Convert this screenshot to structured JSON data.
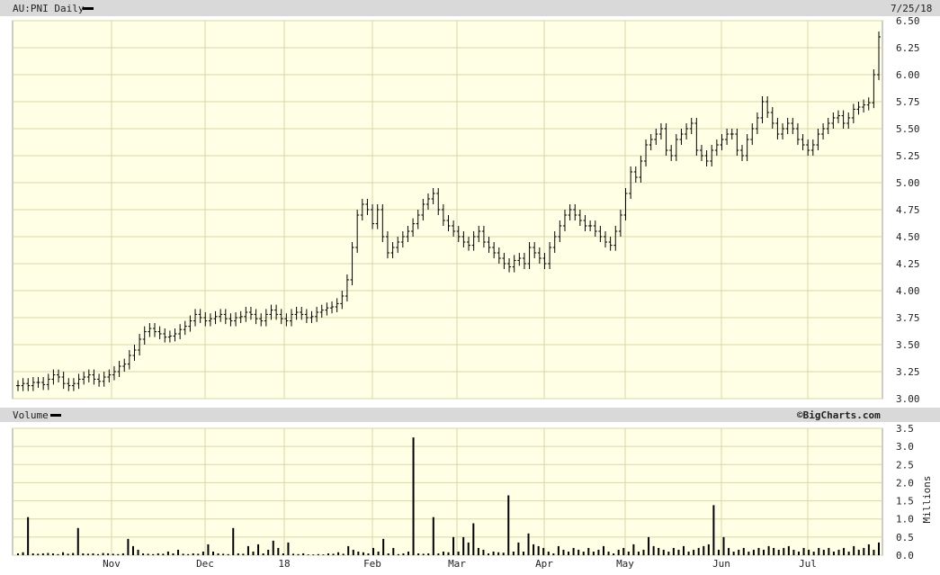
{
  "header": {
    "symbol_label": "AU:PNI Daily",
    "date_label": "7/25/18",
    "volume_label": "Volume",
    "brand": "©BigCharts.com",
    "volume_unit": "Millions"
  },
  "colors": {
    "panel_bg": "#ffffe6",
    "grid": "#d8d6a8",
    "header_bg": "#d9d9d9",
    "ink": "#000000"
  },
  "chart_data": [
    {
      "type": "line",
      "style": "ohlc",
      "title": "AU:PNI Daily",
      "x_tick_labels": [
        "Nov",
        "Dec",
        "18",
        "Feb",
        "Mar",
        "Apr",
        "May",
        "Jun",
        "Jul"
      ],
      "y_tick_labels": [
        "3.00",
        "3.25",
        "3.50",
        "3.75",
        "4.00",
        "4.25",
        "4.50",
        "4.75",
        "5.00",
        "5.25",
        "5.50",
        "5.75",
        "6.00",
        "6.25",
        "6.50"
      ],
      "ylim": [
        3.0,
        6.5
      ],
      "grid": true,
      "series": [
        {
          "values": [
            3.12,
            3.14,
            3.12,
            3.15,
            3.15,
            3.13,
            3.18,
            3.22,
            3.2,
            3.14,
            3.12,
            3.14,
            3.18,
            3.2,
            3.22,
            3.18,
            3.16,
            3.2,
            3.22,
            3.25,
            3.3,
            3.32,
            3.4,
            3.45,
            3.55,
            3.62,
            3.65,
            3.62,
            3.6,
            3.57,
            3.58,
            3.6,
            3.64,
            3.67,
            3.72,
            3.78,
            3.75,
            3.72,
            3.74,
            3.76,
            3.78,
            3.74,
            3.72,
            3.75,
            3.76,
            3.8,
            3.78,
            3.74,
            3.72,
            3.78,
            3.82,
            3.78,
            3.74,
            3.72,
            3.78,
            3.8,
            3.78,
            3.75,
            3.76,
            3.8,
            3.82,
            3.84,
            3.85,
            3.88,
            3.95,
            4.1,
            4.4,
            4.7,
            4.8,
            4.75,
            4.62,
            4.75,
            4.5,
            4.35,
            4.4,
            4.45,
            4.5,
            4.55,
            4.62,
            4.7,
            4.8,
            4.85,
            4.9,
            4.75,
            4.65,
            4.6,
            4.55,
            4.5,
            4.45,
            4.42,
            4.5,
            4.55,
            4.45,
            4.4,
            4.35,
            4.3,
            4.25,
            4.22,
            4.28,
            4.3,
            4.25,
            4.4,
            4.35,
            4.3,
            4.25,
            4.4,
            4.5,
            4.6,
            4.7,
            4.75,
            4.7,
            4.65,
            4.6,
            4.6,
            4.55,
            4.5,
            4.45,
            4.42,
            4.55,
            4.7,
            4.9,
            5.1,
            5.05,
            5.2,
            5.35,
            5.4,
            5.45,
            5.5,
            5.3,
            5.25,
            5.4,
            5.45,
            5.5,
            5.55,
            5.3,
            5.25,
            5.2,
            5.3,
            5.35,
            5.4,
            5.45,
            5.45,
            5.3,
            5.25,
            5.4,
            5.5,
            5.6,
            5.75,
            5.65,
            5.55,
            5.45,
            5.5,
            5.55,
            5.5,
            5.4,
            5.35,
            5.3,
            5.35,
            5.45,
            5.5,
            5.55,
            5.6,
            5.62,
            5.55,
            5.6,
            5.68,
            5.7,
            5.72,
            5.74,
            6.0,
            6.35
          ]
        }
      ]
    },
    {
      "type": "bar",
      "title": "Volume",
      "ylabel": "Millions",
      "x_tick_labels": [
        "Nov",
        "Dec",
        "18",
        "Feb",
        "Mar",
        "Apr",
        "May",
        "Jun",
        "Jul"
      ],
      "y_tick_labels": [
        "0.0",
        "0.5",
        "1.0",
        "1.5",
        "2.0",
        "2.5",
        "3.0",
        "3.5"
      ],
      "ylim": [
        0,
        3.5
      ],
      "grid": true,
      "series": [
        {
          "values": [
            0.05,
            0.08,
            1.05,
            0.05,
            0.04,
            0.05,
            0.06,
            0.05,
            0.03,
            0.08,
            0.04,
            0.06,
            0.75,
            0.05,
            0.04,
            0.05,
            0.03,
            0.06,
            0.05,
            0.04,
            0.03,
            0.05,
            0.45,
            0.25,
            0.15,
            0.05,
            0.04,
            0.03,
            0.05,
            0.04,
            0.1,
            0.05,
            0.15,
            0.04,
            0.03,
            0.05,
            0.04,
            0.1,
            0.3,
            0.1,
            0.05,
            0.04,
            0.03,
            0.75,
            0.05,
            0.04,
            0.25,
            0.1,
            0.3,
            0.05,
            0.15,
            0.4,
            0.2,
            0.05,
            0.35,
            0.04,
            0.03,
            0.05,
            0.02,
            0.02,
            0.03,
            0.02,
            0.05,
            0.04,
            0.08,
            0.04,
            0.25,
            0.15,
            0.1,
            0.08,
            0.05,
            0.2,
            0.1,
            0.45,
            0.05,
            0.2,
            0.03,
            0.05,
            0.1,
            3.25,
            0.05,
            0.04,
            0.05,
            1.05,
            0.05,
            0.1,
            0.08,
            0.5,
            0.1,
            0.5,
            0.35,
            0.88,
            0.2,
            0.15,
            0.05,
            0.1,
            0.08,
            0.07,
            1.65,
            0.1,
            0.35,
            0.1,
            0.6,
            0.3,
            0.25,
            0.2,
            0.1,
            0.05,
            0.25,
            0.15,
            0.1,
            0.2,
            0.15,
            0.1,
            0.2,
            0.1,
            0.15,
            0.25,
            0.1,
            0.05,
            0.15,
            0.2,
            0.1,
            0.3,
            0.1,
            0.15,
            0.5,
            0.25,
            0.2,
            0.15,
            0.1,
            0.2,
            0.15,
            0.25,
            0.1,
            0.15,
            0.2,
            0.25,
            0.3,
            1.38,
            0.15,
            0.5,
            0.2,
            0.1,
            0.15,
            0.2,
            0.1,
            0.15,
            0.2,
            0.15,
            0.25,
            0.2,
            0.15,
            0.2,
            0.25,
            0.15,
            0.1,
            0.2,
            0.15,
            0.1,
            0.2,
            0.15,
            0.2,
            0.1,
            0.15,
            0.2,
            0.1,
            0.25,
            0.15,
            0.2,
            0.3,
            0.15,
            0.35
          ]
        }
      ]
    }
  ]
}
